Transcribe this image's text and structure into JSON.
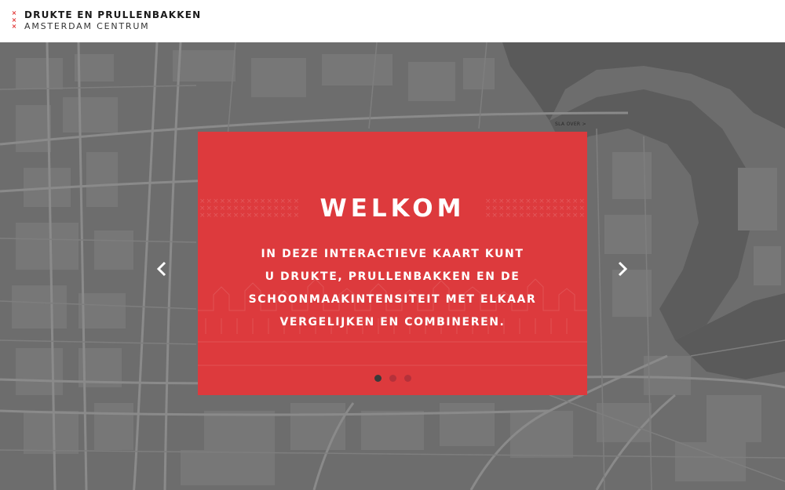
{
  "header": {
    "title": "DRUKTE EN PRULLENBAKKEN",
    "subtitle": "AMSTERDAM CENTRUM",
    "logo_marks": [
      "×",
      "×",
      "×"
    ],
    "logo_icon": "amsterdam-crosses-icon"
  },
  "map": {
    "skip_label": "SLA OVER >"
  },
  "modal": {
    "title": "WELKOM",
    "lines": [
      "IN DEZE INTERACTIEVE KAART KUNT",
      "U DRUKTE, PRULLENBAKKEN EN DE",
      "SCHOONMAAKINTENSITEIT MET ELKAAR",
      "VERGELIJKEN EN COMBINEREN."
    ],
    "pattern": "×××××××××××××××",
    "slides": 3,
    "active_slide": 1
  },
  "nav": {
    "prev_icon": "chevron-left-icon",
    "next_icon": "chevron-right-icon"
  },
  "colors": {
    "accent": "#dd3a3d",
    "map_bg": "#6d6d6d",
    "header_bg": "#ffffff"
  }
}
